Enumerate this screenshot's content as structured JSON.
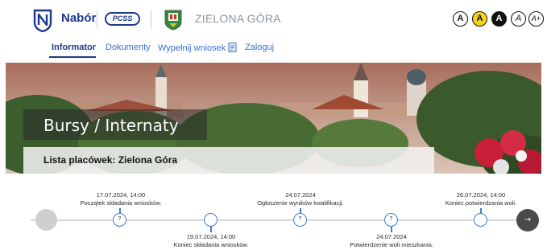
{
  "header": {
    "brand": "Nabór",
    "partner_logo": "PCSS",
    "city": "ZIELONA GÓRA",
    "accessibility": [
      {
        "label": "A",
        "style": "default"
      },
      {
        "label": "A",
        "style": "yellow"
      },
      {
        "label": "A",
        "style": "dark"
      },
      {
        "label": "A",
        "style": "italic"
      },
      {
        "label": "A+",
        "style": "italic"
      }
    ]
  },
  "nav": {
    "items": [
      {
        "label": "Informator",
        "active": true
      },
      {
        "label": "Dokumenty",
        "active": false
      },
      {
        "label": "Wypełnij wniosek",
        "active": false,
        "icon": "document-icon"
      },
      {
        "label": "Zaloguj",
        "active": false
      }
    ]
  },
  "banner": {
    "title": "Bursy / Internaty",
    "subtitle": "Lista placówek: Zielona Góra"
  },
  "timeline": {
    "events": [
      {
        "date": "17.07.2024, 14:00",
        "label": "Początek składania wniosków.",
        "position": "above",
        "marker": "?"
      },
      {
        "date": "19.07.2024, 14:00",
        "label": "Koniec składania wniosków.",
        "position": "below",
        "marker": ""
      },
      {
        "date": "24.07.2024",
        "label": "Ogłoszenie wyników kwalifikacji.",
        "position": "above",
        "marker": "?"
      },
      {
        "date": "24.07.2024",
        "label": "Potwierdzenie woli mieszkania.",
        "position": "below",
        "marker": "?"
      },
      {
        "date": "26.07.2024, 14:00",
        "label": "Koniec potwierdzania woli.",
        "position": "above",
        "marker": ""
      }
    ],
    "next_icon": "→",
    "colors": {
      "accent": "#3c7ddb",
      "navy": "#1d3a8a"
    }
  }
}
